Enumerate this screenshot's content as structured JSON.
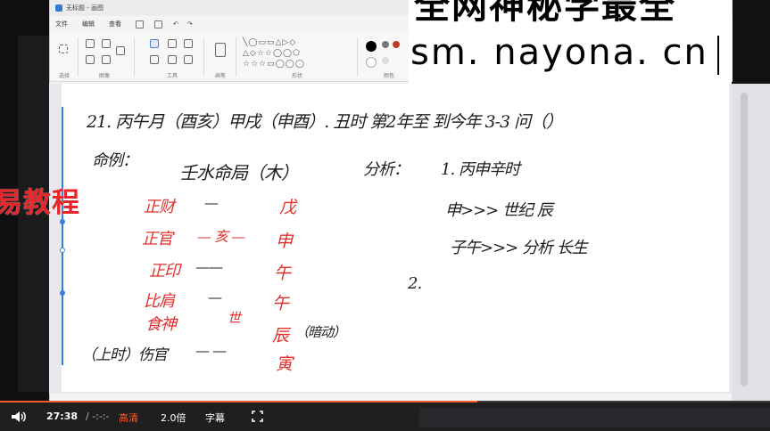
{
  "paint": {
    "title": "无标题 - 画图",
    "menu": [
      "文件",
      "编辑",
      "查看"
    ],
    "ribbon_groups": [
      "选择",
      "图像",
      "工具",
      "画笔",
      "形状",
      "颜色"
    ]
  },
  "watermark": {
    "line1": "全网神秘学最全",
    "line2": "sm. nayona. cn"
  },
  "overlay": {
    "left_text": "易教程"
  },
  "notes": {
    "line1": "21. 丙午月（酉亥）甲戌（申酉）. 丑时 第2年至 到今年 3-3 问（）",
    "label_mingli": "命例：",
    "label_fenxi": "分析：",
    "chart_title": "壬水命局（木）",
    "analysis_1": "1. 丙申辛时",
    "analysis_1a": "申>>> 世纪 辰",
    "analysis_1b": "子午>>> 分析 长生",
    "analysis_2": "2.",
    "rows": [
      {
        "left": "正财",
        "mid": "—",
        "right": "戊"
      },
      {
        "left": "正官",
        "mid": "— 亥 —",
        "right": "申"
      },
      {
        "left": "正印",
        "mid": "——",
        "right": "午"
      },
      {
        "left": "比肩",
        "mid": "—",
        "right": "午"
      },
      {
        "left": "食神",
        "mid": "世",
        "right": "辰"
      },
      {
        "left": "（上时）伤官",
        "mid": "—  —",
        "right": "寅"
      }
    ],
    "side_note": "（暗动）"
  },
  "player": {
    "time_current": "27:38",
    "time_total": "/ -:-:-",
    "quality": "高清",
    "speed": "2.0倍",
    "subtitle": "字幕",
    "progress": 0.62
  },
  "colors": {
    "accent_red": "#e0302b",
    "accent_blue": "#3a7bdc",
    "player_bg": "#1f1f1f"
  }
}
